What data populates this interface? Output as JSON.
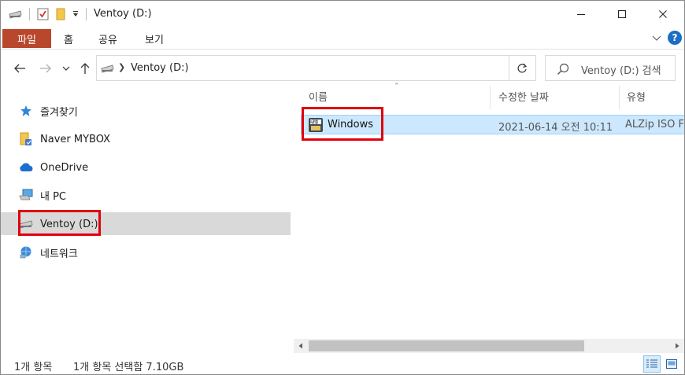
{
  "window": {
    "title": "Ventoy (D:)"
  },
  "ribbon": {
    "tabs": [
      {
        "label": "파일"
      },
      {
        "label": "홈"
      },
      {
        "label": "공유"
      },
      {
        "label": "보기"
      }
    ],
    "help_label": "?"
  },
  "address": {
    "path": "Ventoy (D:)",
    "search_placeholder": "Ventoy (D:) 검색"
  },
  "nav": {
    "items": [
      {
        "label": "즐겨찾기",
        "icon": "star-icon"
      },
      {
        "label": "Naver MYBOX",
        "icon": "mybox-folder-icon"
      },
      {
        "label": "OneDrive",
        "icon": "cloud-icon"
      },
      {
        "label": "내 PC",
        "icon": "computer-icon"
      },
      {
        "label": "Ventoy (D:)",
        "icon": "drive-icon",
        "selected": true
      },
      {
        "label": "네트워크",
        "icon": "network-icon"
      }
    ]
  },
  "columns": {
    "name": "이름",
    "modified": "수정한 날짜",
    "type": "유형"
  },
  "files": [
    {
      "name": "Windows",
      "modified": "2021-06-14 오전 10:11",
      "type": "ALZip ISO Fi",
      "icon": "iso-file-icon",
      "selected": true
    }
  ],
  "status": {
    "item_count": "1개 항목",
    "selection": "1개 항목 선택함 7.10GB"
  },
  "colors": {
    "file_tab": "#b9472c",
    "selection_bg": "#cce8ff",
    "nav_selected_bg": "#d9d9d9",
    "highlight_box": "#e0000f"
  }
}
